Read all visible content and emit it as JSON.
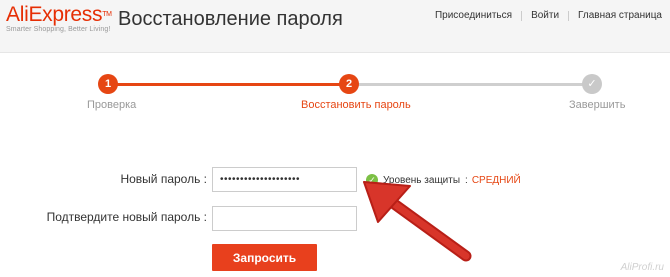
{
  "header": {
    "logo_text": "AliExpress",
    "logo_tm": "TM",
    "logo_slogan": "Smarter Shopping, Better Living!",
    "title": "Восстановление пароля",
    "nav": [
      {
        "label": "Присоединиться"
      },
      {
        "label": "Войти"
      },
      {
        "label": "Главная страница"
      }
    ]
  },
  "stepper": {
    "steps": [
      {
        "number": "1",
        "label": "Проверка",
        "state": "done"
      },
      {
        "number": "2",
        "label": "Восстановить пароль",
        "state": "current"
      },
      {
        "number": "✓",
        "label": "Завершить",
        "state": "pending"
      }
    ],
    "colors": {
      "active": "#e64613",
      "inactive": "#c9c9c9"
    }
  },
  "form": {
    "new_password_label": "Новый пароль :",
    "new_password_value": "••••••••••••••••••••",
    "confirm_label": "Подтвердите новый пароль :",
    "confirm_value": "",
    "strength_label": "Уровень защиты",
    "strength_value": "СРЕДНИЙ",
    "submit_label": "Запросить"
  },
  "watermark": "AliProfi.ru",
  "colors": {
    "accent": "#e64613",
    "button": "#e8401d",
    "annotation_arrow": "#c8241b"
  }
}
